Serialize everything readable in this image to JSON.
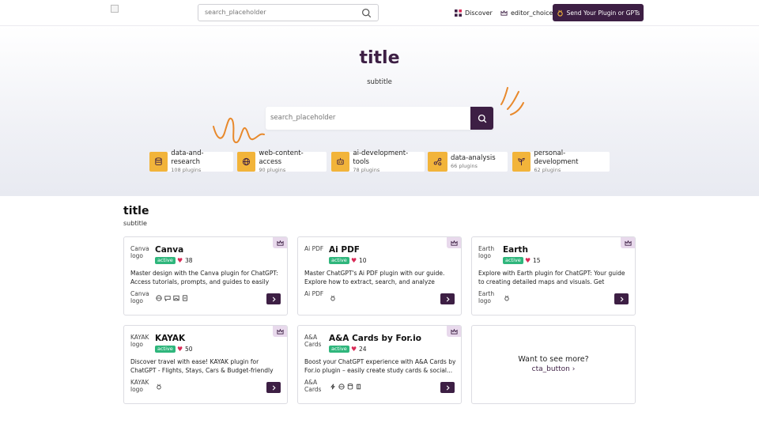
{
  "header": {
    "search_placeholder": "search_placeholder",
    "nav": [
      {
        "label": "Discover",
        "icon": "grid-icon"
      },
      {
        "label": "editor_choice",
        "icon": "crown-icon"
      }
    ],
    "send_button": "Send Your Plugin or GPTs"
  },
  "hero": {
    "title": "title",
    "subtitle": "subtitle",
    "search_placeholder": "search_placeholder",
    "categories": [
      {
        "name": "data-and-research",
        "count": "108 plugins",
        "icon": "database-icon"
      },
      {
        "name": "web-content-access",
        "count": "90 plugins",
        "icon": "globe-icon"
      },
      {
        "name": "ai-development-tools",
        "count": "78 plugins",
        "icon": "robot-icon"
      },
      {
        "name": "data-analysis",
        "count": "66 plugins",
        "icon": "share-nodes-icon"
      },
      {
        "name": "personal-development",
        "count": "62 plugins",
        "icon": "growth-icon"
      }
    ]
  },
  "section": {
    "title": "title",
    "subtitle": "subtitle",
    "cards": [
      {
        "name": "Canva",
        "logo_alt": "Canva logo",
        "status": "active",
        "likes": "38",
        "desc": "Master design with the Canva plugin for ChatGPT: Access tutorials, prompts, and guides to easily creat..."
      },
      {
        "name": "Ai PDF",
        "logo_alt": "Ai PDF",
        "status": "active",
        "likes": "10",
        "desc": "Master ChatGPT's Ai PDF plugin with our guide. Explore how to extract, search, and analyze PDFs..."
      },
      {
        "name": "Earth",
        "logo_alt": "Earth logo",
        "status": "active",
        "likes": "15",
        "desc": "Explore with Earth plugin for ChatGPT: Your guide to creating detailed maps and visuals. Get tutorials &..."
      },
      {
        "name": "KAYAK",
        "logo_alt": "KAYAK logo",
        "status": "active",
        "likes": "50",
        "desc": "Discover travel with ease! KAYAK plugin for ChatGPT - Flights, Stays, Cars & Budget-friendly destinations...."
      },
      {
        "name": "A&A Cards by For.io",
        "logo_alt": "A&A Cards",
        "status": "active",
        "likes": "24",
        "desc": "Boost your ChatGPT experience with A&A Cards by For.io plugin – easily create study cards & social..."
      }
    ],
    "more_title": "Want to see more?",
    "more_cta": "cta_button"
  },
  "colors": {
    "brand": "#3d1f44",
    "accent": "#f2b43a",
    "active": "#2fb67c",
    "heart": "#d92a56",
    "squiggle": "#e8892c"
  }
}
